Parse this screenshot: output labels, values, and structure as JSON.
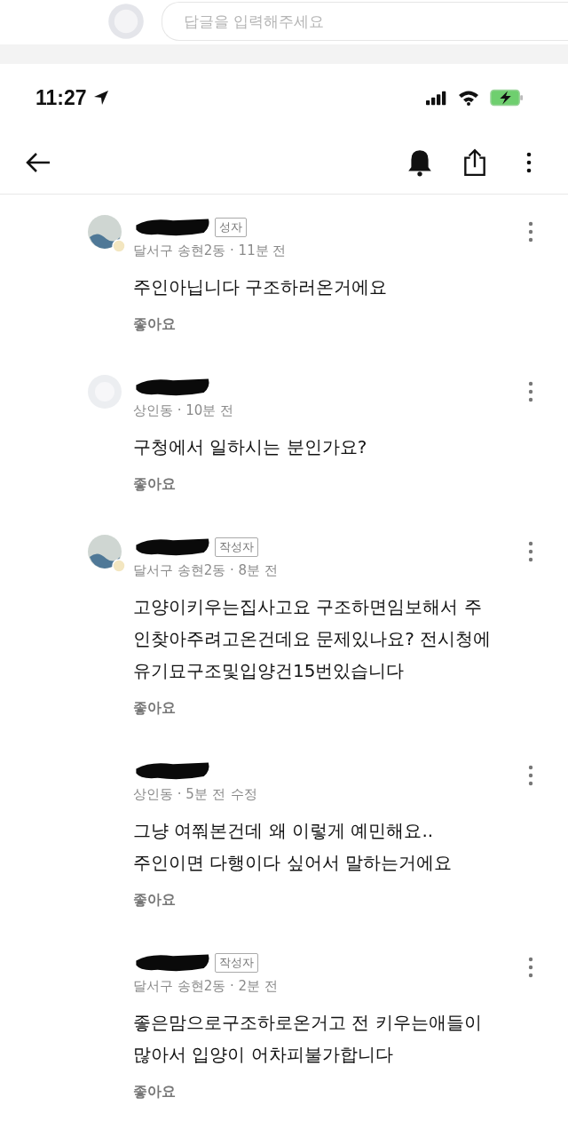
{
  "reply_strip": {
    "placeholder": "답글을 입력해주세요"
  },
  "status_bar": {
    "time": "11:27"
  },
  "comments": [
    {
      "avatar": {
        "kind": "photo"
      },
      "name_redacted": true,
      "badge": "성자",
      "meta": "달서구 송현2동 · 11분 전",
      "body_lines": [
        "주인아닙니다 구조하러온거에요"
      ],
      "like": "좋아요"
    },
    {
      "avatar": {
        "kind": "default"
      },
      "name_redacted": true,
      "meta": "상인동 · 10분 전",
      "body_lines": [
        "구청에서 일하시는 분인가요?"
      ],
      "like": "좋아요"
    },
    {
      "avatar": {
        "kind": "photo"
      },
      "name_redacted": true,
      "badge": "작성자",
      "meta": "달서구 송현2동 · 8분 전",
      "body_lines": [
        "고양이키우는집사고요 구조하면임보해서 주",
        "인찾아주려고온건데요 문제있나요? 전시청에",
        "유기묘구조및입양건15번있습니다"
      ],
      "like": "좋아요"
    },
    {
      "name_redacted": true,
      "meta": "상인동 · 5분 전",
      "edit_link": "수정",
      "body_lines": [
        "그냥 여쭤본건데 왜 이렇게 예민해요..",
        "주인이면 다행이다 싶어서 말하는거에요"
      ],
      "like": "좋아요"
    },
    {
      "name_redacted": true,
      "badge": "작성자",
      "meta": "달서구 송현2동 · 2분 전",
      "body_lines": [
        "좋은맘으로구조하로온거고 전 키우는애들이",
        "많아서 입양이 어차피불가합니다"
      ],
      "like": "좋아요"
    }
  ]
}
